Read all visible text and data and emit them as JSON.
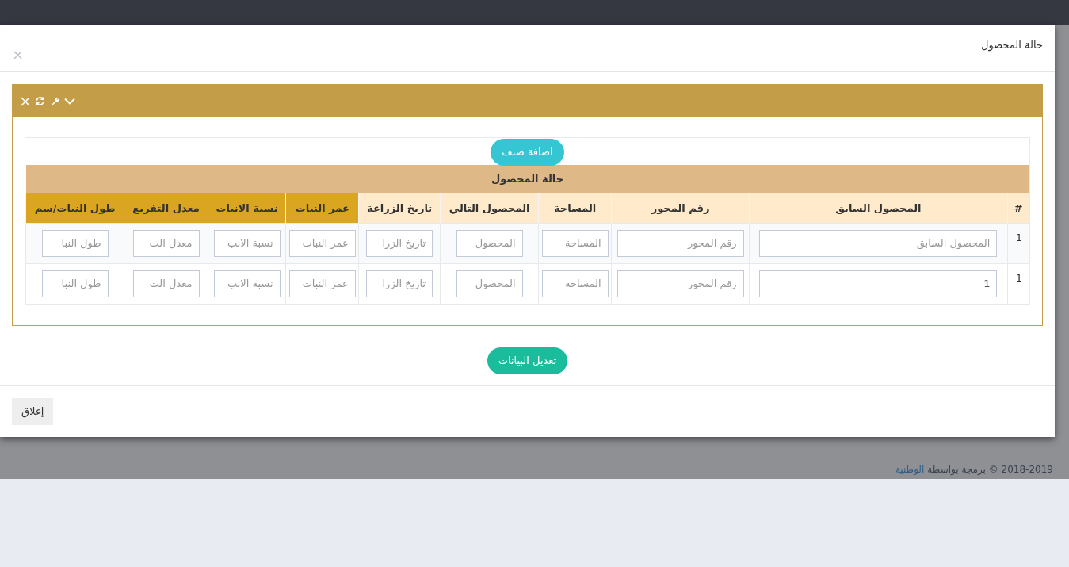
{
  "modal": {
    "title": "حالة المحصول",
    "close_glyph": "×",
    "add_button": "اضافة صنف",
    "table": {
      "caption": "حالة المحصول",
      "columns": [
        {
          "label": "#",
          "color": "#ffeacb"
        },
        {
          "label": "المحصول السابق",
          "color": "#ffeacb"
        },
        {
          "label": "رقم المحور",
          "color": "#ffeacb"
        },
        {
          "label": "المساحة",
          "color": "#ffeacb"
        },
        {
          "label": "المحصول التالي",
          "color": "#ffeacb"
        },
        {
          "label": "تاريخ الزراعة",
          "color": "#ffeacb"
        },
        {
          "label": "عمر النبات",
          "color": "#daa520"
        },
        {
          "label": "نسبة الانبات",
          "color": "#daa520"
        },
        {
          "label": "معدل التفريغ",
          "color": "#daa520"
        },
        {
          "label": "طول النبات/سم",
          "color": "#daa520"
        }
      ],
      "rows": [
        {
          "cells": [
            {
              "kind": "text",
              "text": "1"
            },
            {
              "kind": "input",
              "placeholder": "المحصول السابق"
            },
            {
              "kind": "input",
              "placeholder": "رقم المحور"
            },
            {
              "kind": "input",
              "placeholder": "المساحة"
            },
            {
              "kind": "input",
              "placeholder": "المحصول"
            },
            {
              "kind": "input",
              "placeholder": "تاريخ الزرا"
            },
            {
              "kind": "input",
              "placeholder": "عمر النبات"
            },
            {
              "kind": "input",
              "placeholder": "نسبة الانب"
            },
            {
              "kind": "input",
              "placeholder": "معدل الت"
            },
            {
              "kind": "input",
              "placeholder": "طول النبا"
            }
          ]
        },
        {
          "cells": [
            {
              "kind": "text",
              "text": "1"
            },
            {
              "kind": "input",
              "value": "1"
            },
            {
              "kind": "input",
              "placeholder": "رقم المحور"
            },
            {
              "kind": "input",
              "placeholder": "المساحة"
            },
            {
              "kind": "input",
              "placeholder": "المحصول"
            },
            {
              "kind": "input",
              "placeholder": "تاريخ الزرا"
            },
            {
              "kind": "input",
              "placeholder": "عمر النبات"
            },
            {
              "kind": "input",
              "placeholder": "نسبة الانب"
            },
            {
              "kind": "input",
              "placeholder": "معدل الت"
            },
            {
              "kind": "input",
              "placeholder": "طول النبا"
            }
          ]
        }
      ]
    },
    "submit_button": "تعديل البيانات",
    "close_button": "إغلاق"
  },
  "footer": {
    "text": "2018-2019 © برمجة بواسطة",
    "link": "الوطنية"
  }
}
